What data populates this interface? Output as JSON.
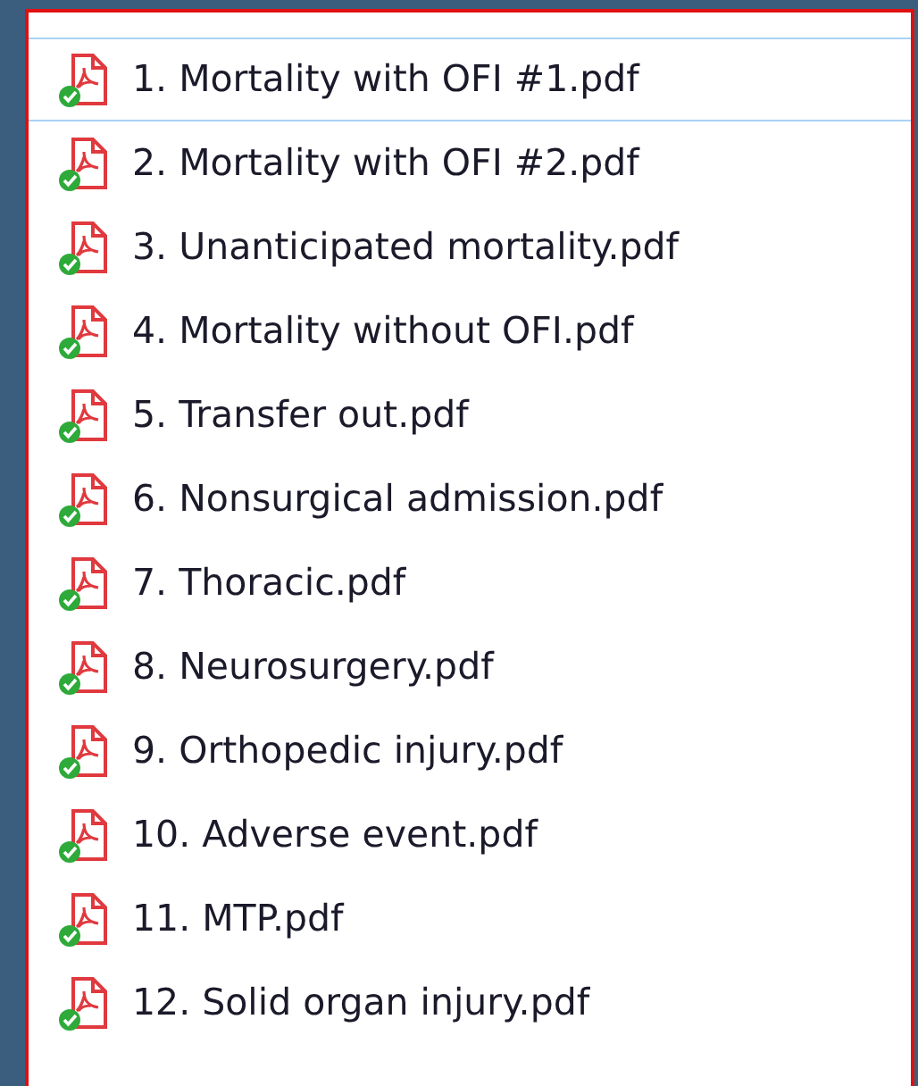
{
  "files": [
    {
      "name": "1. Mortality with OFI #1.pdf",
      "selected": true
    },
    {
      "name": "2. Mortality with OFI #2.pdf",
      "selected": false
    },
    {
      "name": "3. Unanticipated mortality.pdf",
      "selected": false
    },
    {
      "name": "4. Mortality without OFI.pdf",
      "selected": false
    },
    {
      "name": "5. Transfer out.pdf",
      "selected": false
    },
    {
      "name": "6. Nonsurgical admission.pdf",
      "selected": false
    },
    {
      "name": "7. Thoracic.pdf",
      "selected": false
    },
    {
      "name": "8. Neurosurgery.pdf",
      "selected": false
    },
    {
      "name": "9. Orthopedic injury.pdf",
      "selected": false
    },
    {
      "name": "10. Adverse event.pdf",
      "selected": false
    },
    {
      "name": "11. MTP.pdf",
      "selected": false
    },
    {
      "name": "12. Solid organ injury.pdf",
      "selected": false
    }
  ]
}
